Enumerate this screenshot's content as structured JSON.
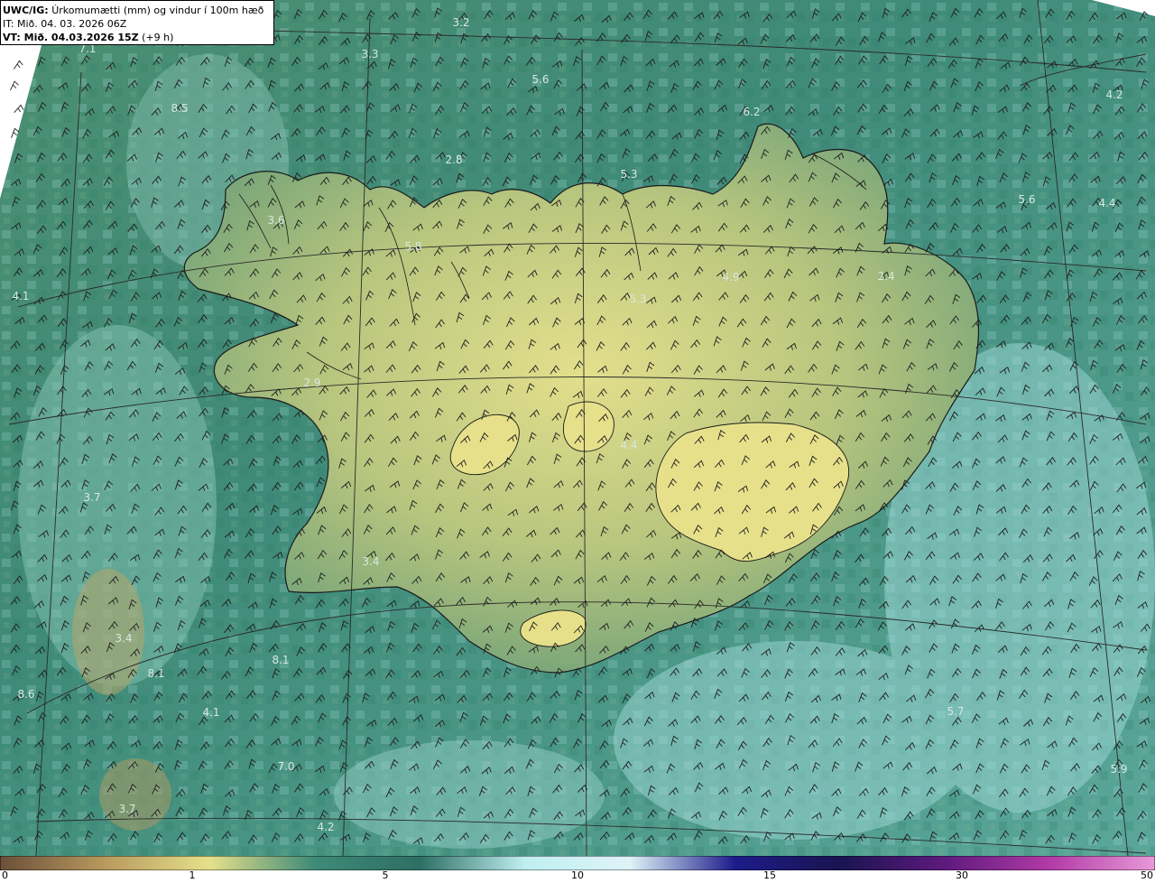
{
  "header": {
    "model": "UWC/IG:",
    "product": "Úrkomumætti (mm) og vindur í 100m hæð",
    "init_time": "IT: Mið. 04. 03. 2026 06Z",
    "valid_label": "VT: Mið. 04.03.2026 15Z",
    "lead_time": "(+9 h)"
  },
  "colorbar": {
    "ticks": [
      "0",
      "1",
      "5",
      "10",
      "15",
      "30",
      "50"
    ],
    "colors": [
      "#6b4f3a",
      "#b89a5e",
      "#e6e08a",
      "#3e8a78",
      "#2e6f64",
      "#bfeff0",
      "#dff3f8",
      "#1c1c8a",
      "#1a1450",
      "#5e1a7e",
      "#b23aa6",
      "#e89ad8"
    ]
  },
  "map_labels": [
    "3.2",
    "3.3",
    "7.1",
    "5.6",
    "8.5",
    "6.2",
    "4.2",
    "2.8",
    "5.3",
    "5.6",
    "4.4",
    "3.6",
    "5.8",
    "4.9",
    "2.4",
    "4.1",
    "5.3",
    "2.9",
    "4.4",
    "3.7",
    "3.4",
    "3.4",
    "8.1",
    "8.1",
    "8.6",
    "4.1",
    "7.0",
    "5.7",
    "5.9",
    "3.7",
    "4.2"
  ],
  "palette": {
    "sea": "#3f8a78",
    "land_low": "#5f9a74",
    "land_high": "#d9d98a",
    "coast": "#1a1a1a",
    "grid": "#2a2a2a",
    "barb": "#1f1f1f",
    "label": "#d8e8e0"
  }
}
